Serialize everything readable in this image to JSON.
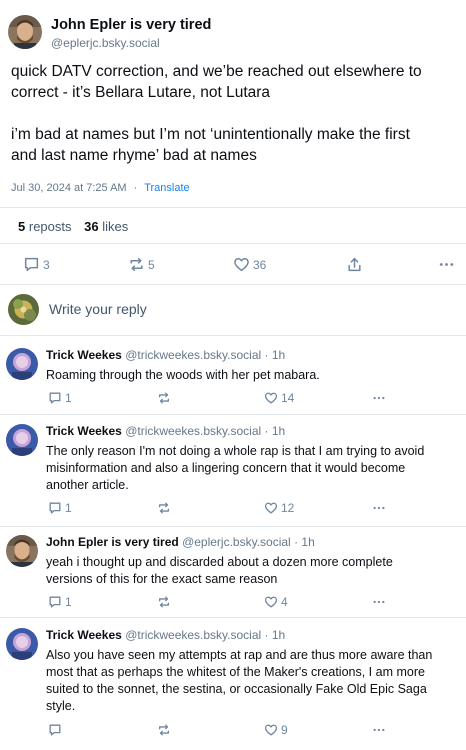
{
  "main_post": {
    "author_name": "John Epler is very tired",
    "author_handle": "@eplerjc.bsky.social",
    "text_line1": "quick DATV correction, and we’be reached out elsewhere to",
    "text_line2": "correct - it’s Bellara Lutare, not Lutara",
    "text_line3": "i’m bad at names but I’m not ‘unintentionally make the first",
    "text_line4": "and last name rhyme’ bad at names",
    "timestamp": "Jul 30, 2024 at 7:25 AM",
    "separator": "·",
    "translate_label": "Translate",
    "reposts_count": "5",
    "reposts_label": "reposts",
    "likes_count": "36",
    "likes_label": "likes",
    "actions": {
      "replies": "3",
      "reposts": "5",
      "likes": "36"
    }
  },
  "reply_box": {
    "placeholder": "Write your reply"
  },
  "replies": [
    {
      "author_name": "Trick Weekes",
      "author_handle": "@trickweekes.bsky.social",
      "time": "· 1h",
      "lines": [
        "Roaming through the woods with her pet mabara."
      ],
      "reply_count": "1",
      "like_count": "14"
    },
    {
      "author_name": "Trick Weekes",
      "author_handle": "@trickweekes.bsky.social",
      "time": "· 1h",
      "lines": [
        "The only reason I'm not doing a whole rap is that I am trying to avoid",
        "misinformation and also a lingering concern that it would become",
        "another article."
      ],
      "reply_count": "1",
      "like_count": "12"
    },
    {
      "author_name": "John Epler is very tired",
      "author_handle": "@eplerjc.bsky.social",
      "time": "· 1h",
      "lines": [
        "yeah i thought up and discarded about a dozen more complete",
        "versions of this for the exact same reason"
      ],
      "reply_count": "1",
      "like_count": "4"
    },
    {
      "author_name": "Trick Weekes",
      "author_handle": "@trickweekes.bsky.social",
      "time": "· 1h",
      "lines": [
        "Also you have seen my attempts at rap and are thus more aware than",
        "most that as perhaps the whitest of the Maker's creations, I am more",
        "suited to the sonnet, the sestina, or occasionally Fake Old Epic Saga",
        "style."
      ],
      "reply_count": "",
      "like_count": "9"
    }
  ],
  "colors": {
    "accent": "#1083fe",
    "muted_text": "#66788a",
    "icon": "#6f869f",
    "divider": "#e4e9ee"
  },
  "icons": [
    "speech-bubble-icon",
    "repost-icon",
    "heart-icon",
    "share-icon",
    "more-icon"
  ]
}
